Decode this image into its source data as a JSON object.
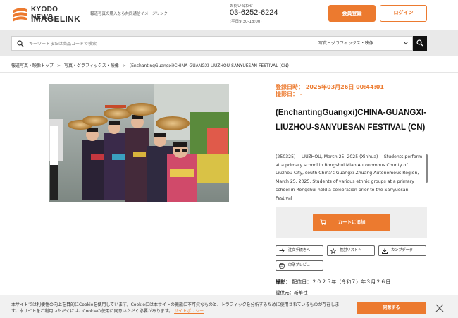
{
  "header": {
    "logo_line1": "KYODO NEWS",
    "logo_line2": "IMAGELINK",
    "tagline": "報道写真の購入なら共同通信イメージリンク",
    "contact_label": "お問い合わせ",
    "contact_phone": "03-6252-6224",
    "contact_hours": "(平日9:30-18:00)",
    "register_label": "会員登録",
    "login_label": "ログイン"
  },
  "search": {
    "placeholder": "キーワードまたは商品コードで検索",
    "category_selected": "写真・グラフィックス・映像"
  },
  "breadcrumb": {
    "items": [
      "報道写真・映像トップ",
      "写真・グラフィックス・映像",
      "(EnchantingGuangxi)CHINA-GUANGXI-LIUZHOU-SANYUESAN FESTIVAL (CN)"
    ]
  },
  "product": {
    "registered": "登録日時：  2025年03月26日  00:44:01",
    "shot_label": "撮影日：  -",
    "title": "(EnchantingGuangxi)CHINA-GUANGXI-LIUZHOU-SANYUESAN FESTIVAL (CN)",
    "description": "(250325) -- LIUZHOU, March 25, 2025 (Xinhua) -- Students perform at a primary school in Rongshui Miao Autonomous County of Liuzhou City, south China's Guangxi Zhuang Autonomous Region, March 25, 2025. Students of various ethnic groups at a primary school in Rongshui held a celebration prior to the Sanyuesan Festival",
    "cart_label": "カートに追加",
    "btn_order": "注文手続きへ",
    "btn_wishlist": "検討リストへ",
    "btn_compdata": "カンプデータ",
    "btn_print": "印刷プレビュー",
    "shot_info_label": "撮影：",
    "shot_info_value": "配信日：２０２５年（令和７）年３月２６日",
    "provider_label": "提供元：新華社"
  },
  "cookie": {
    "text": "本サイトでは利便性の向上を目的にCookieを使用しています。Cookieには本サイトの機能に不可欠なものと、トラフィックを分析するために使用されているものが存在します。本サイトをご利用いただくには、Cookieの使用に同意いただく必要があります。",
    "policy_link": "サイトポリシー",
    "agree_label": "同意する"
  },
  "colors": {
    "accent": "#ec7a2f",
    "search_band": "#e9e9e9"
  },
  "icons": [
    "search-icon",
    "chevron-down-icon",
    "cart-icon",
    "arrow-right-icon",
    "star-icon",
    "download-icon",
    "print-icon",
    "close-icon"
  ]
}
